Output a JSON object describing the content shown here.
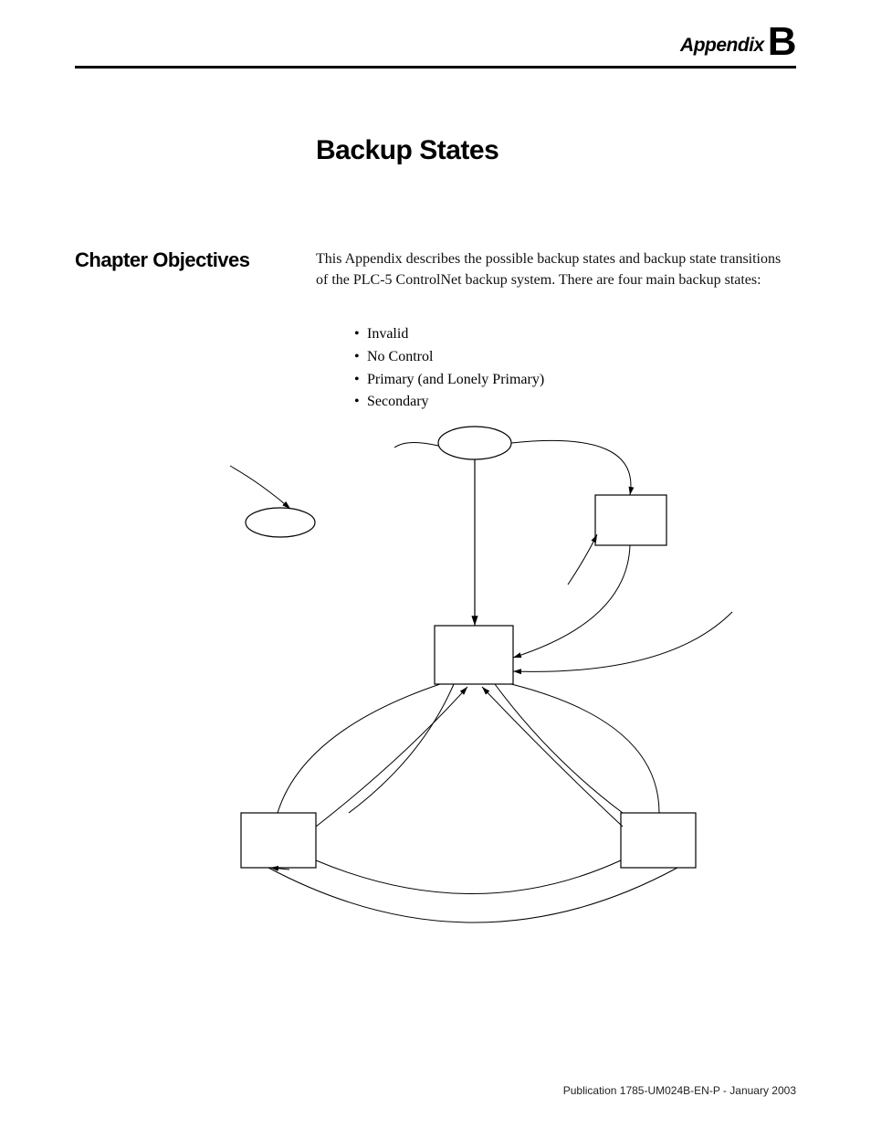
{
  "header": {
    "appendix_label": "Appendix",
    "appendix_letter": "B"
  },
  "title": "Backup States",
  "section_heading": "Chapter Objectives",
  "body_paragraph": "This Appendix describes the possible backup states and backup state transitions of the PLC-5 ControlNet backup system. There are four main backup states:",
  "bullets": [
    "Invalid",
    "No Control",
    "Primary (and Lonely Primary)",
    "Secondary"
  ],
  "footer": "Publication 1785-UM024B-EN-P - January 2003"
}
